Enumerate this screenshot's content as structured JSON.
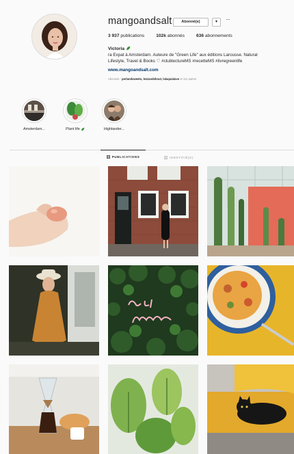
{
  "profile": {
    "username": "mangoandsalt",
    "follow_button_label": "Abonné(e)",
    "dropdown_icon": "chevron-down-icon",
    "more_icon": "more-options-icon",
    "more_glyph": "···",
    "stats": {
      "posts_count": "3 937",
      "posts_label": "publications",
      "followers_count": "102k",
      "followers_label": "abonnés",
      "following_count": "636",
      "following_label": "abonnements"
    },
    "full_name": "Victoria",
    "bio_line1": "ra Expat à Amsterdam. Auteure de \"Green Life\" aux éditions Larousse. Natural",
    "bio_line2": "Lifestyle, Travel & Books ♡ #clublectureMS #recetteMS #livregreenlife",
    "website": "www.mangoandsalt.com",
    "followed_by_prefix": "Abonnés :",
    "followed_by_names": "perlandsweets, lezzandehout, lalaquialave",
    "followed_by_suffix": "et 111 autres"
  },
  "highlights": [
    {
      "label": "Amsterdam..."
    },
    {
      "label": "Plant life"
    },
    {
      "label": "Highlander..."
    }
  ],
  "tabs": {
    "publications": "PUBLICATIONS",
    "tagged": "IDENTIFIÉ(E)"
  },
  "posts": [
    {
      "subject": "hand holding pink stone"
    },
    {
      "subject": "woman in front of brick house"
    },
    {
      "subject": "cactus greenhouse"
    },
    {
      "subject": "woman in yellow dress with hat"
    },
    {
      "subject": "and breathe neon sign"
    },
    {
      "subject": "pasta plate on yellow"
    },
    {
      "subject": "chemex coffee breakfast"
    },
    {
      "subject": "green plant leaves"
    },
    {
      "subject": "black cat on yellow cushion"
    }
  ]
}
